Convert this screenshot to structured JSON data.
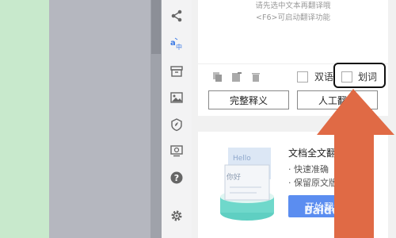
{
  "hint": {
    "line1": "请先选中文本再翻译哦",
    "line2": "<F6>可启动翻译功能"
  },
  "options": {
    "bilingual_label": "双语",
    "word_pick_label": "划词"
  },
  "buttons": {
    "full_definition": "完整释义",
    "human_translation": "人工翻译"
  },
  "doc_translate": {
    "title": "文档全文翻译",
    "features": [
      "· 快速准确",
      "· 保留原文版式"
    ],
    "start_button": "开始翻译",
    "illustration_hello": "Hello",
    "illustration_nihao": "你好"
  },
  "watermark": "Baidu 经验",
  "colors": {
    "accent": "#5b8df0",
    "arrow": "#e06a45",
    "translate_icon": "#3d7be5"
  },
  "icons": [
    "share-icon",
    "translate-icon",
    "archive-icon",
    "image-icon",
    "shield-icon",
    "screenshot-icon",
    "help-icon",
    "settings-icon"
  ]
}
